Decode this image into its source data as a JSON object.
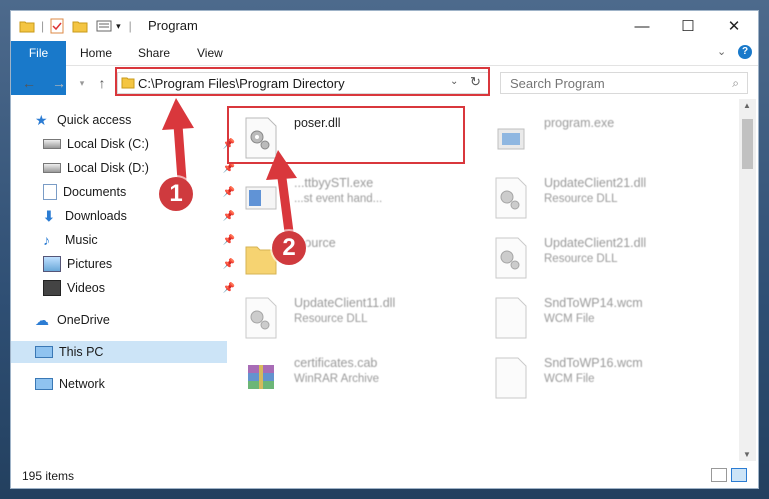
{
  "window": {
    "title": "Program",
    "controls": {
      "minimize": "—",
      "maximize": "☐",
      "close": "✕"
    }
  },
  "ribbon": {
    "tabs": [
      "File",
      "Home",
      "Share",
      "View"
    ]
  },
  "nav": {
    "address": "C:\\Program Files\\Program Directory",
    "search_placeholder": "Search Program"
  },
  "sidebar": {
    "items": [
      {
        "label": "Quick access",
        "icon": "star-icon"
      },
      {
        "label": "Local Disk (C:)",
        "icon": "drive-icon",
        "pinned": true
      },
      {
        "label": "Local Disk (D:)",
        "icon": "drive-icon",
        "pinned": true
      },
      {
        "label": "Documents",
        "icon": "documents-icon",
        "pinned": true
      },
      {
        "label": "Downloads",
        "icon": "download-icon",
        "pinned": true
      },
      {
        "label": "Music",
        "icon": "music-icon",
        "pinned": true
      },
      {
        "label": "Pictures",
        "icon": "pictures-icon",
        "pinned": true
      },
      {
        "label": "Videos",
        "icon": "videos-icon",
        "pinned": true
      },
      {
        "label": "OneDrive",
        "icon": "cloud-icon"
      },
      {
        "label": "This PC",
        "icon": "pc-icon",
        "selected": true
      },
      {
        "label": "Network",
        "icon": "network-icon"
      }
    ]
  },
  "files": [
    {
      "name": "poser.dll",
      "desc": "",
      "icon": "dll-gear-icon"
    },
    {
      "name": "program.exe",
      "desc": "",
      "icon": "exe-icon"
    },
    {
      "name": "...ttbyySTl.exe",
      "desc": "...st event hand...",
      "icon": "exe-icon"
    },
    {
      "name": "UpdateClient21.dll",
      "desc": "Resource DLL",
      "icon": "dll-gear-icon"
    },
    {
      "name": "...ource",
      "desc": "",
      "icon": "folder-icon"
    },
    {
      "name": "UpdateClient21.dll",
      "desc": "Resource DLL",
      "icon": "dll-gear-icon"
    },
    {
      "name": "UpdateClient11.dll",
      "desc": "Resource DLL",
      "icon": "dll-gear-icon"
    },
    {
      "name": "SndToWP14.wcm",
      "desc": "WCM File",
      "icon": "file-icon"
    },
    {
      "name": "certificates.cab",
      "desc": "WinRAR Archive",
      "icon": "winrar-icon"
    },
    {
      "name": "SndToWP16.wcm",
      "desc": "WCM File",
      "icon": "file-icon"
    }
  ],
  "status": {
    "count": "195 items"
  },
  "annotations": {
    "step1": "1",
    "step2": "2",
    "color": "#d9373c"
  }
}
